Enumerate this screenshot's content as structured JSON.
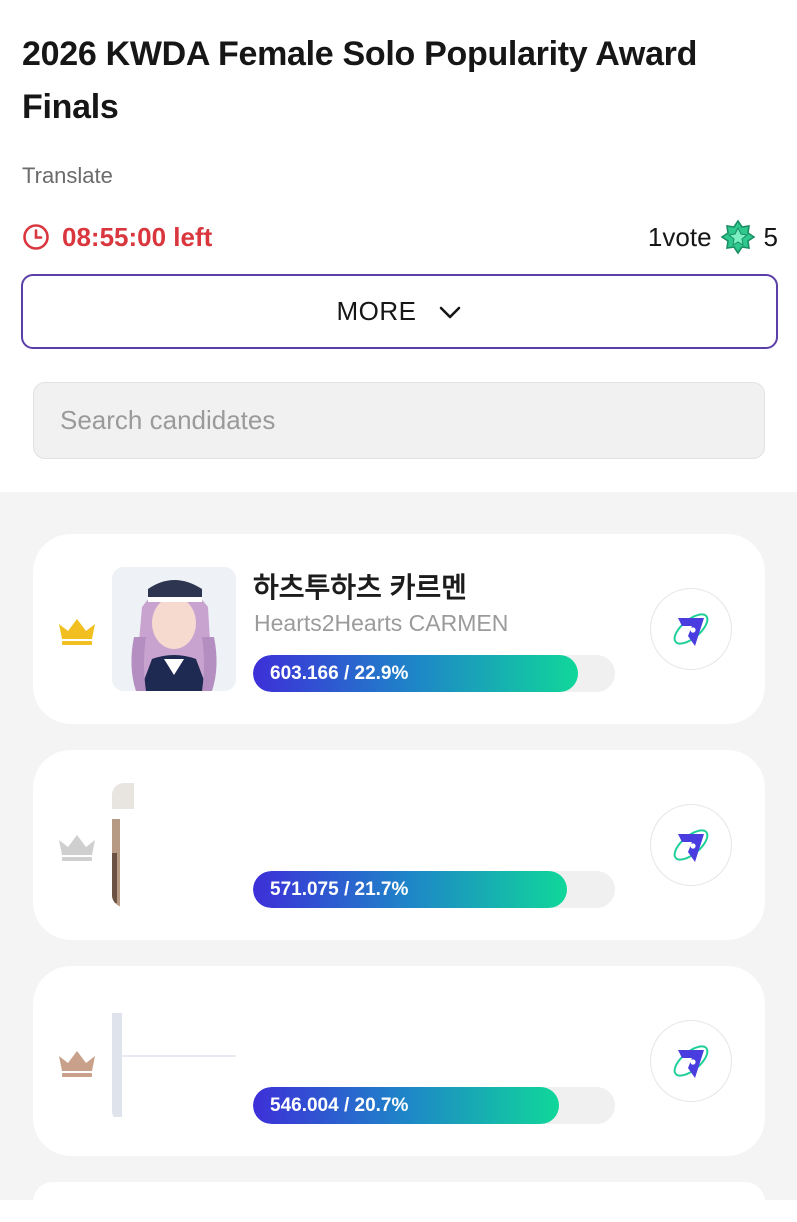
{
  "header": {
    "title": "2026 KWDA Female Solo Popularity Award Finals",
    "translate_label": "Translate",
    "time_left": "08:55:00 left",
    "vote_label": "1vote",
    "vote_cost": "5",
    "more_label": "MORE"
  },
  "search": {
    "placeholder": "Search candidates",
    "value": ""
  },
  "candidates": [
    {
      "rank_icon": "gold-crown-icon",
      "name_ko": "하츠투하츠 카르멘",
      "name_en": "Hearts2Hearts CARMEN",
      "votes_text": "603.166 / 22.9%",
      "share": 0.899
    },
    {
      "rank_icon": "silver-crown-icon",
      "name_ko": "",
      "name_en": "",
      "votes_text": "571.075 / 21.7%",
      "share": 0.868
    },
    {
      "rank_icon": "bronze-crown-icon",
      "name_ko": "",
      "name_en": "",
      "votes_text": "546.004 / 20.7%",
      "share": 0.845
    }
  ],
  "colors": {
    "timer_red": "#d9363e",
    "accent_purple": "#5b3fa8",
    "bar_start": "#3d2fd8",
    "bar_end": "#10d79a",
    "gold": "#f2bf21",
    "silver": "#cfcfcf",
    "bronze": "#c9a08a"
  }
}
